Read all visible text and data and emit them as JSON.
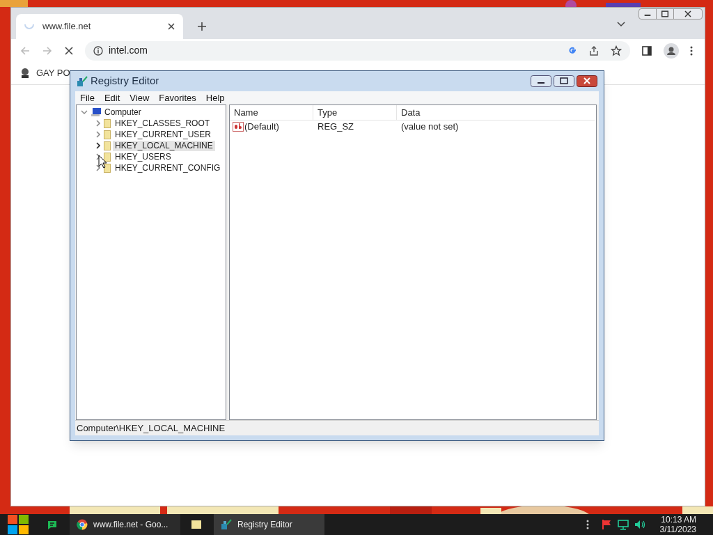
{
  "browser": {
    "tabs": [
      {
        "title": "www.file.net",
        "loading": true,
        "selected": true
      }
    ],
    "address": "intel.com",
    "bookmarks": [
      "GAY PO"
    ]
  },
  "registry_editor": {
    "title": "Registry Editor",
    "menu": [
      "File",
      "Edit",
      "View",
      "Favorites",
      "Help"
    ],
    "tree": {
      "label": "Computer",
      "expanded": true,
      "children": [
        {
          "label": "HKEY_CLASSES_ROOT",
          "expanded": false,
          "selected": false
        },
        {
          "label": "HKEY_CURRENT_USER",
          "expanded": false,
          "selected": false
        },
        {
          "label": "HKEY_LOCAL_MACHINE",
          "expanded": false,
          "selected": true
        },
        {
          "label": "HKEY_USERS",
          "expanded": false,
          "selected": false
        },
        {
          "label": "HKEY_CURRENT_CONFIG",
          "expanded": false,
          "selected": false
        }
      ]
    },
    "columns": [
      "Name",
      "Type",
      "Data"
    ],
    "rows": [
      {
        "name": "(Default)",
        "type": "REG_SZ",
        "data": "(value not set)"
      }
    ],
    "status_bar": "Computer\\HKEY_LOCAL_MACHINE"
  },
  "taskbar": {
    "items": [
      {
        "kind": "chat",
        "selected": false
      },
      {
        "kind": "browser",
        "label": "www.file.net - Goo...",
        "selected": false
      },
      {
        "kind": "folder",
        "selected": false
      },
      {
        "kind": "registry",
        "label": "Registry Editor",
        "selected": true
      }
    ],
    "time": "10:13 AM",
    "date": "3/11/2023"
  }
}
